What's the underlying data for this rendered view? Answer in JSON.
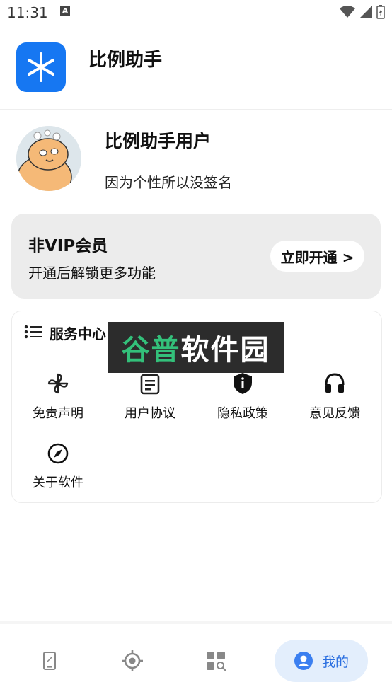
{
  "status": {
    "time": "11:31"
  },
  "app": {
    "title": "比例助手"
  },
  "profile": {
    "name": "比例助手用户",
    "signature": "因为个性所以没签名"
  },
  "vip": {
    "title": "非VIP会员",
    "subtitle": "开通后解锁更多功能",
    "button_label": "立即开通 >"
  },
  "service": {
    "title": "服务中心",
    "items": [
      {
        "label": "免责声明",
        "icon": "pinwheel-icon"
      },
      {
        "label": "用户协议",
        "icon": "document-icon"
      },
      {
        "label": "隐私政策",
        "icon": "shield-icon"
      },
      {
        "label": "意见反馈",
        "icon": "headset-icon"
      },
      {
        "label": "关于软件",
        "icon": "compass-icon"
      }
    ]
  },
  "watermark": {
    "part1": "谷普",
    "part2": "软件园"
  },
  "nav": {
    "mine_label": "我的"
  },
  "colors": {
    "accent": "#1677f2",
    "nav_active_bg": "#e3eefc",
    "nav_active_text": "#2b6fe0",
    "card_bg": "#ececec"
  }
}
